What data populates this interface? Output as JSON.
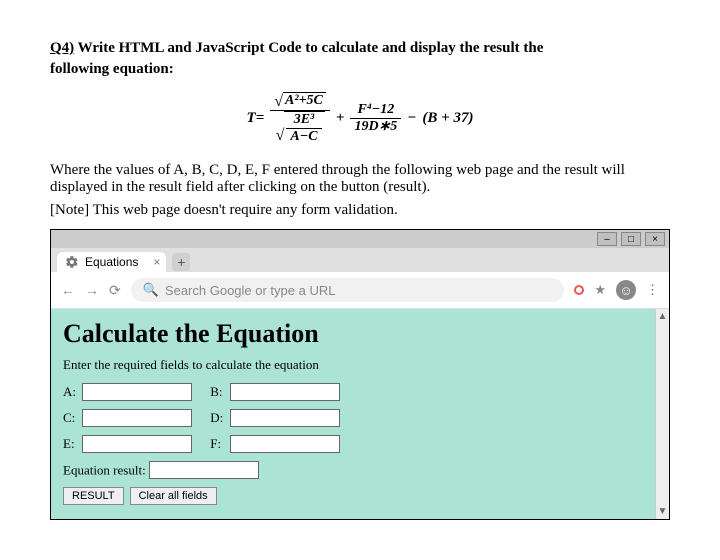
{
  "question": {
    "number": "Q4)",
    "prompt_line1": "Write HTML and JavaScript Code to calculate and display the result the",
    "prompt_line2": "following equation:"
  },
  "equation": {
    "lhs": "T=",
    "frac1_num": "A²+5C",
    "frac1_den_num": "3E³",
    "frac1_den_den": "A−C",
    "plus": "+",
    "frac2_num": "F⁴−12",
    "frac2_den": "19D∗5",
    "minus": "−",
    "tail": "(B + 37)"
  },
  "explain": {
    "line1": "Where the values of A, B, C, D, E, F entered through the following web page and the result will displayed in the result field after clicking on the button (result).",
    "note": "[Note] This web page doesn't require any form validation."
  },
  "browser": {
    "win_min": "–",
    "win_max": "□",
    "win_close": "×",
    "tab_title": "Equations",
    "tab_close": "×",
    "new_tab": "+",
    "nav_back": "←",
    "nav_fwd": "→",
    "nav_reload": "⟳",
    "omnibox_placeholder": "Search Google or type a URL",
    "star": "★",
    "menu": "⋮"
  },
  "page": {
    "heading": "Calculate the Equation",
    "sub": "Enter the required fields to calculate the equation",
    "labels": {
      "a": "A:",
      "b": "B:",
      "c": "C:",
      "d": "D:",
      "e": "E:",
      "f": "F:"
    },
    "result_label": "Equation result:",
    "btn_result": "RESULT",
    "btn_clear": "Clear all fields"
  }
}
